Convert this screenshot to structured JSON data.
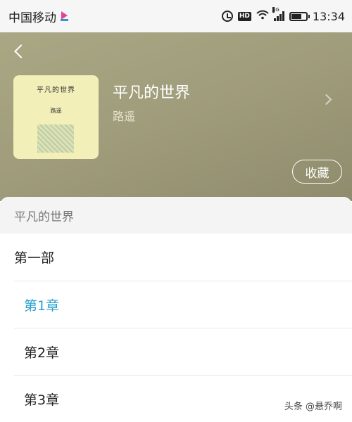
{
  "status_bar": {
    "carrier": "中国移动",
    "signal_tag": "4G",
    "hd_badge": "HD",
    "time": "13:34",
    "battery_level": 0.7
  },
  "header": {
    "cover_title": "平凡的世界",
    "cover_author": "路遥",
    "book_title": "平凡的世界",
    "book_author": "路遥",
    "collect_label": "收藏"
  },
  "sheet": {
    "title": "平凡的世界",
    "volume_label": "第一部",
    "chapters": [
      {
        "label": "第1章",
        "active": true
      },
      {
        "label": "第2章",
        "active": false
      },
      {
        "label": "第3章",
        "active": false
      }
    ]
  },
  "watermark": "头条 @悬乔啊",
  "colors": {
    "accent": "#2a9fd0",
    "header_bg": "#a09d7c"
  }
}
